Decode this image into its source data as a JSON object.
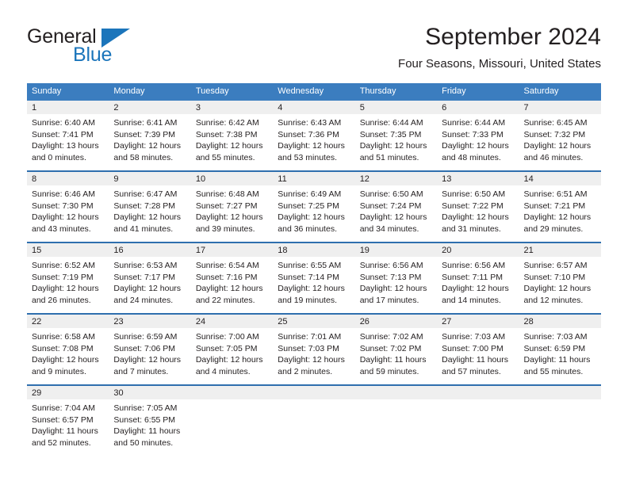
{
  "brand": {
    "word_one": "General",
    "word_two": "Blue",
    "flag_icon": "triangle-flag-icon"
  },
  "header": {
    "title": "September 2024",
    "subtitle": "Four Seasons, Missouri, United States"
  },
  "weekdays": [
    "Sunday",
    "Monday",
    "Tuesday",
    "Wednesday",
    "Thursday",
    "Friday",
    "Saturday"
  ],
  "colors": {
    "header_blue": "#3b7dbf",
    "row_divider_blue": "#2f6fae",
    "daynum_band": "#efefef",
    "brand_blue": "#1b75bb",
    "text": "#231f20"
  },
  "weeks": [
    [
      {
        "day": "1",
        "sunrise": "Sunrise: 6:40 AM",
        "sunset": "Sunset: 7:41 PM",
        "daylight_1": "Daylight: 13 hours",
        "daylight_2": "and 0 minutes."
      },
      {
        "day": "2",
        "sunrise": "Sunrise: 6:41 AM",
        "sunset": "Sunset: 7:39 PM",
        "daylight_1": "Daylight: 12 hours",
        "daylight_2": "and 58 minutes."
      },
      {
        "day": "3",
        "sunrise": "Sunrise: 6:42 AM",
        "sunset": "Sunset: 7:38 PM",
        "daylight_1": "Daylight: 12 hours",
        "daylight_2": "and 55 minutes."
      },
      {
        "day": "4",
        "sunrise": "Sunrise: 6:43 AM",
        "sunset": "Sunset: 7:36 PM",
        "daylight_1": "Daylight: 12 hours",
        "daylight_2": "and 53 minutes."
      },
      {
        "day": "5",
        "sunrise": "Sunrise: 6:44 AM",
        "sunset": "Sunset: 7:35 PM",
        "daylight_1": "Daylight: 12 hours",
        "daylight_2": "and 51 minutes."
      },
      {
        "day": "6",
        "sunrise": "Sunrise: 6:44 AM",
        "sunset": "Sunset: 7:33 PM",
        "daylight_1": "Daylight: 12 hours",
        "daylight_2": "and 48 minutes."
      },
      {
        "day": "7",
        "sunrise": "Sunrise: 6:45 AM",
        "sunset": "Sunset: 7:32 PM",
        "daylight_1": "Daylight: 12 hours",
        "daylight_2": "and 46 minutes."
      }
    ],
    [
      {
        "day": "8",
        "sunrise": "Sunrise: 6:46 AM",
        "sunset": "Sunset: 7:30 PM",
        "daylight_1": "Daylight: 12 hours",
        "daylight_2": "and 43 minutes."
      },
      {
        "day": "9",
        "sunrise": "Sunrise: 6:47 AM",
        "sunset": "Sunset: 7:28 PM",
        "daylight_1": "Daylight: 12 hours",
        "daylight_2": "and 41 minutes."
      },
      {
        "day": "10",
        "sunrise": "Sunrise: 6:48 AM",
        "sunset": "Sunset: 7:27 PM",
        "daylight_1": "Daylight: 12 hours",
        "daylight_2": "and 39 minutes."
      },
      {
        "day": "11",
        "sunrise": "Sunrise: 6:49 AM",
        "sunset": "Sunset: 7:25 PM",
        "daylight_1": "Daylight: 12 hours",
        "daylight_2": "and 36 minutes."
      },
      {
        "day": "12",
        "sunrise": "Sunrise: 6:50 AM",
        "sunset": "Sunset: 7:24 PM",
        "daylight_1": "Daylight: 12 hours",
        "daylight_2": "and 34 minutes."
      },
      {
        "day": "13",
        "sunrise": "Sunrise: 6:50 AM",
        "sunset": "Sunset: 7:22 PM",
        "daylight_1": "Daylight: 12 hours",
        "daylight_2": "and 31 minutes."
      },
      {
        "day": "14",
        "sunrise": "Sunrise: 6:51 AM",
        "sunset": "Sunset: 7:21 PM",
        "daylight_1": "Daylight: 12 hours",
        "daylight_2": "and 29 minutes."
      }
    ],
    [
      {
        "day": "15",
        "sunrise": "Sunrise: 6:52 AM",
        "sunset": "Sunset: 7:19 PM",
        "daylight_1": "Daylight: 12 hours",
        "daylight_2": "and 26 minutes."
      },
      {
        "day": "16",
        "sunrise": "Sunrise: 6:53 AM",
        "sunset": "Sunset: 7:17 PM",
        "daylight_1": "Daylight: 12 hours",
        "daylight_2": "and 24 minutes."
      },
      {
        "day": "17",
        "sunrise": "Sunrise: 6:54 AM",
        "sunset": "Sunset: 7:16 PM",
        "daylight_1": "Daylight: 12 hours",
        "daylight_2": "and 22 minutes."
      },
      {
        "day": "18",
        "sunrise": "Sunrise: 6:55 AM",
        "sunset": "Sunset: 7:14 PM",
        "daylight_1": "Daylight: 12 hours",
        "daylight_2": "and 19 minutes."
      },
      {
        "day": "19",
        "sunrise": "Sunrise: 6:56 AM",
        "sunset": "Sunset: 7:13 PM",
        "daylight_1": "Daylight: 12 hours",
        "daylight_2": "and 17 minutes."
      },
      {
        "day": "20",
        "sunrise": "Sunrise: 6:56 AM",
        "sunset": "Sunset: 7:11 PM",
        "daylight_1": "Daylight: 12 hours",
        "daylight_2": "and 14 minutes."
      },
      {
        "day": "21",
        "sunrise": "Sunrise: 6:57 AM",
        "sunset": "Sunset: 7:10 PM",
        "daylight_1": "Daylight: 12 hours",
        "daylight_2": "and 12 minutes."
      }
    ],
    [
      {
        "day": "22",
        "sunrise": "Sunrise: 6:58 AM",
        "sunset": "Sunset: 7:08 PM",
        "daylight_1": "Daylight: 12 hours",
        "daylight_2": "and 9 minutes."
      },
      {
        "day": "23",
        "sunrise": "Sunrise: 6:59 AM",
        "sunset": "Sunset: 7:06 PM",
        "daylight_1": "Daylight: 12 hours",
        "daylight_2": "and 7 minutes."
      },
      {
        "day": "24",
        "sunrise": "Sunrise: 7:00 AM",
        "sunset": "Sunset: 7:05 PM",
        "daylight_1": "Daylight: 12 hours",
        "daylight_2": "and 4 minutes."
      },
      {
        "day": "25",
        "sunrise": "Sunrise: 7:01 AM",
        "sunset": "Sunset: 7:03 PM",
        "daylight_1": "Daylight: 12 hours",
        "daylight_2": "and 2 minutes."
      },
      {
        "day": "26",
        "sunrise": "Sunrise: 7:02 AM",
        "sunset": "Sunset: 7:02 PM",
        "daylight_1": "Daylight: 11 hours",
        "daylight_2": "and 59 minutes."
      },
      {
        "day": "27",
        "sunrise": "Sunrise: 7:03 AM",
        "sunset": "Sunset: 7:00 PM",
        "daylight_1": "Daylight: 11 hours",
        "daylight_2": "and 57 minutes."
      },
      {
        "day": "28",
        "sunrise": "Sunrise: 7:03 AM",
        "sunset": "Sunset: 6:59 PM",
        "daylight_1": "Daylight: 11 hours",
        "daylight_2": "and 55 minutes."
      }
    ],
    [
      {
        "day": "29",
        "sunrise": "Sunrise: 7:04 AM",
        "sunset": "Sunset: 6:57 PM",
        "daylight_1": "Daylight: 11 hours",
        "daylight_2": "and 52 minutes."
      },
      {
        "day": "30",
        "sunrise": "Sunrise: 7:05 AM",
        "sunset": "Sunset: 6:55 PM",
        "daylight_1": "Daylight: 11 hours",
        "daylight_2": "and 50 minutes."
      },
      {
        "day": "",
        "sunrise": "",
        "sunset": "",
        "daylight_1": "",
        "daylight_2": ""
      },
      {
        "day": "",
        "sunrise": "",
        "sunset": "",
        "daylight_1": "",
        "daylight_2": ""
      },
      {
        "day": "",
        "sunrise": "",
        "sunset": "",
        "daylight_1": "",
        "daylight_2": ""
      },
      {
        "day": "",
        "sunrise": "",
        "sunset": "",
        "daylight_1": "",
        "daylight_2": ""
      },
      {
        "day": "",
        "sunrise": "",
        "sunset": "",
        "daylight_1": "",
        "daylight_2": ""
      }
    ]
  ]
}
